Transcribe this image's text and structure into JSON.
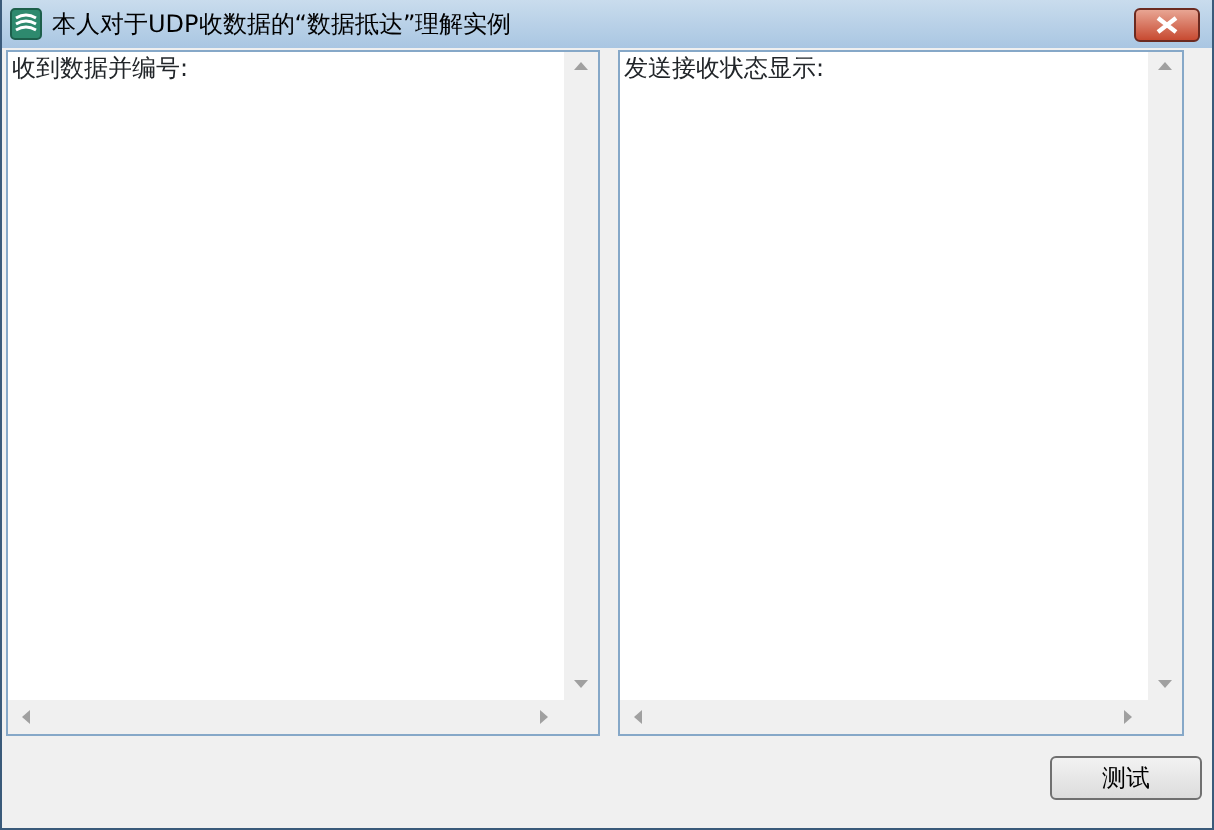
{
  "window": {
    "title": "本人对于UDP收数据的“数据抵达”理解实例"
  },
  "panels": [
    {
      "text": "收到数据并编号:"
    },
    {
      "text": "发送接收状态显示:"
    }
  ],
  "button": {
    "label": "测试"
  }
}
